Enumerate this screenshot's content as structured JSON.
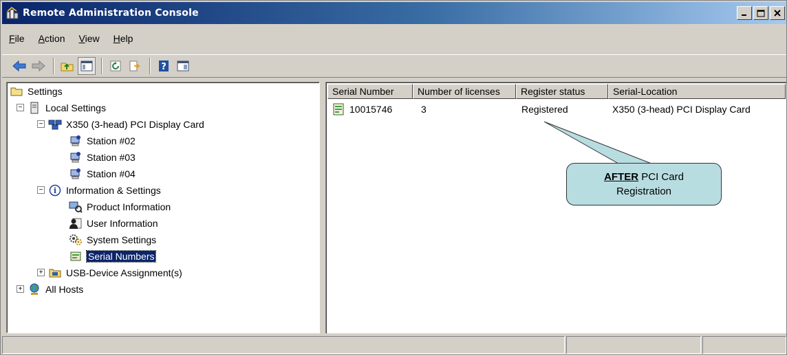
{
  "window": {
    "title": "Remote Administration Console"
  },
  "menu": {
    "items": [
      {
        "label": "File",
        "underline": "F",
        "rest": "ile"
      },
      {
        "label": "Action",
        "underline": "A",
        "rest": "ction"
      },
      {
        "label": "View",
        "underline": "V",
        "rest": "iew"
      },
      {
        "label": "Help",
        "underline": "H",
        "rest": "elp"
      }
    ]
  },
  "toolbar": {
    "buttons": [
      "back-icon",
      "forward-icon",
      "up-folder-icon",
      "show-hide-tree-icon",
      "refresh-icon",
      "export-list-icon",
      "help-icon",
      "properties-icon"
    ]
  },
  "tree": {
    "root": "Settings",
    "local_settings": "Local Settings",
    "card": "X350 (3-head)  PCI Display Card",
    "stations": [
      "Station #02",
      "Station #03",
      "Station #04"
    ],
    "info_settings": "Information & Settings",
    "info_children": [
      "Product Information",
      "User Information",
      "System Settings",
      "Serial Numbers"
    ],
    "usb": "USB-Device Assignment(s)",
    "all_hosts": "All Hosts"
  },
  "list": {
    "columns": [
      "Serial Number",
      "Number of licenses",
      "Register status",
      "Serial-Location"
    ],
    "rows": [
      {
        "serial": "10015746",
        "licenses": "3",
        "status": "Registered",
        "location": "X350 (3-head)  PCI Display Card"
      }
    ]
  },
  "callout": {
    "bold": "AFTER",
    "line1_rest": " PCI Card",
    "line2": "Registration"
  },
  "colors": {
    "title_gradient_start": "#0a246a",
    "title_gradient_end": "#a6caf0",
    "face": "#d4d0c8",
    "callout_fill": "#b8dde1",
    "selection": "#0a246a"
  }
}
